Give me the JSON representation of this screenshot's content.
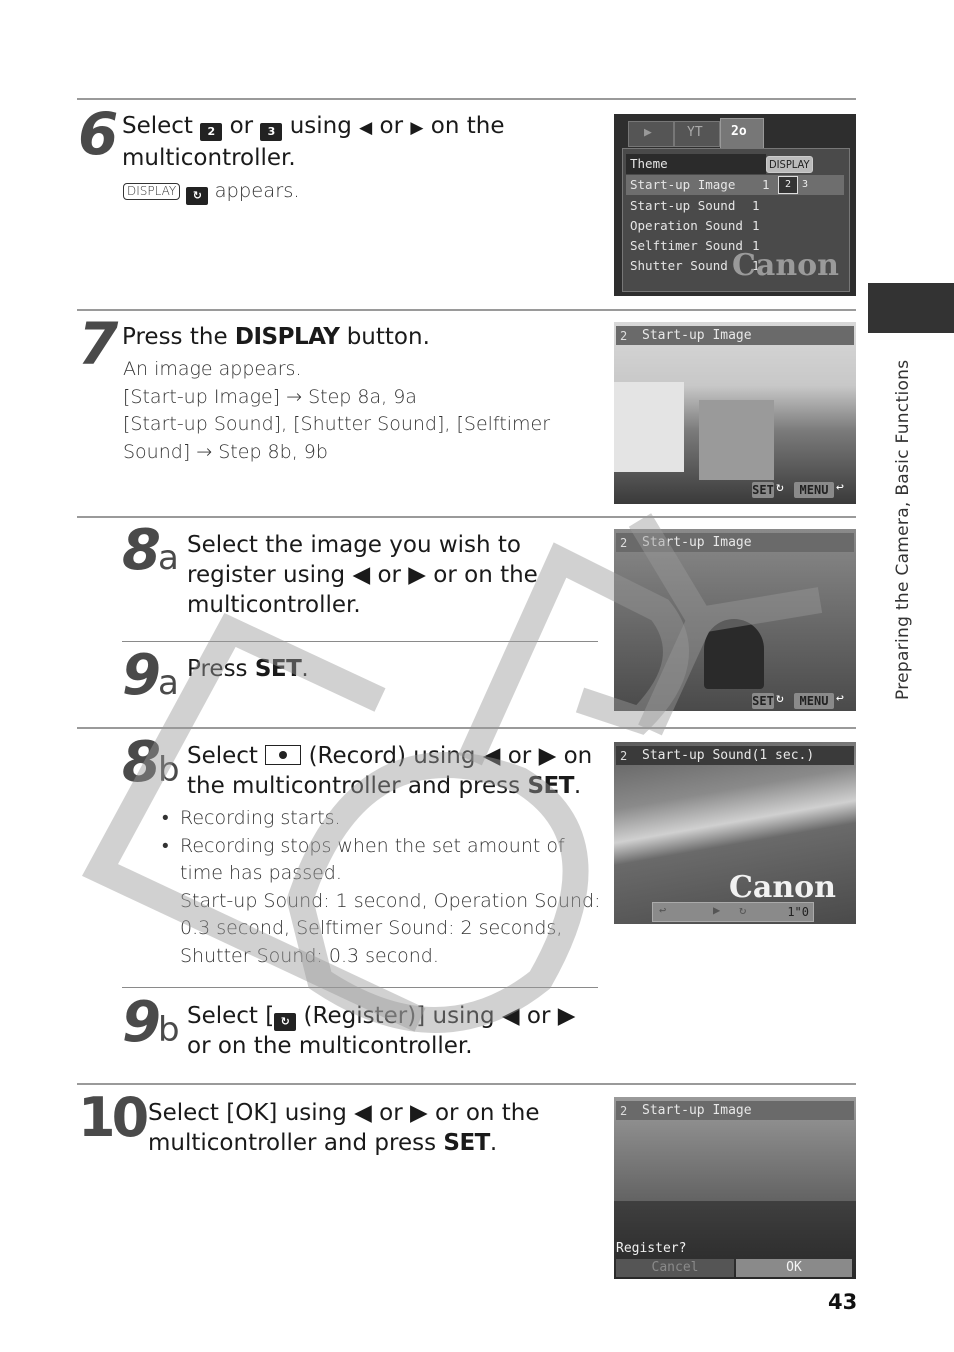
{
  "page": {
    "section_title": "Preparing the Camera, Basic Functions",
    "page_number": "43",
    "watermark": "COPY"
  },
  "steps": {
    "s6": {
      "number": "6",
      "heading_parts": [
        "Select ",
        " or ",
        " using ",
        " or ",
        " on the multicontroller."
      ],
      "icon_a": "2",
      "icon_b": "3",
      "note_display": "DISPLAY",
      "note_text": " appears."
    },
    "s7": {
      "number": "7",
      "heading_pre": "Press the ",
      "heading_key": "DISPLAY",
      "heading_post": " button.",
      "lines": [
        "An image appears.",
        "[Start-up Image] → Step 8a, 9a",
        "[Start-up Sound], [Shutter Sound], [Selftimer",
        "Sound] → Step 8b, 9b"
      ]
    },
    "s8a": {
      "number": "8",
      "sub": "a",
      "lines": [
        "Select the image you wish to",
        "register using ◀ or ▶ or on the",
        "multicontroller."
      ]
    },
    "s9a": {
      "number": "9",
      "sub": "a",
      "heading_pre": "Press ",
      "heading_key": "SET",
      "heading_post": "."
    },
    "s8b": {
      "number": "8",
      "sub": "b",
      "line1_pre": "Select ",
      "line1_post": " (Record) using ◀ or ▶ on",
      "line2_pre": "the multicontroller and press ",
      "line2_key": "SET",
      "line2_post": ".",
      "bullets": [
        "Recording starts.",
        "Recording stops when the set amount of time has passed."
      ],
      "details": [
        "Start-up Sound: 1 second, Operation Sound:",
        "0.3 second, Selftimer Sound: 2 seconds,",
        "Shutter Sound: 0.3 second."
      ]
    },
    "s9b": {
      "number": "9",
      "sub": "b",
      "line1_pre": "Select [",
      "line1_post": " (Register)] using ◀ or ▶",
      "line2": "or on the multicontroller."
    },
    "s10": {
      "number": "10",
      "line1": "Select [OK] using ◀ or ▶ or on the",
      "line2_pre": "multicontroller and press ",
      "line2_key": "SET",
      "line2_post": "."
    }
  },
  "screens": {
    "menu": {
      "tabs": [
        "▶",
        "YT",
        "2o"
      ],
      "rows": [
        {
          "label": "Theme",
          "value": "DISPLAY"
        },
        {
          "label": "Start-up Image",
          "value": "1"
        },
        {
          "label": "Start-up Sound",
          "value": "1"
        },
        {
          "label": "Operation Sound",
          "value": "1"
        },
        {
          "label": "Selftimer Sound",
          "value": "1"
        },
        {
          "label": "Shutter Sound",
          "value": "1"
        }
      ],
      "brand": "Canon"
    },
    "startup_image_1": {
      "title": "Start-up Image",
      "set": "SET",
      "menu": "MENU"
    },
    "startup_image_2": {
      "title": "Start-up Image",
      "set": "SET",
      "menu": "MENU"
    },
    "startup_sound": {
      "title": "Start-up Sound(1 sec.)",
      "brand": "Canon",
      "time": "1\"0"
    },
    "register": {
      "title": "Start-up Image",
      "prompt": "Register?",
      "cancel": "Cancel",
      "ok": "OK"
    }
  }
}
